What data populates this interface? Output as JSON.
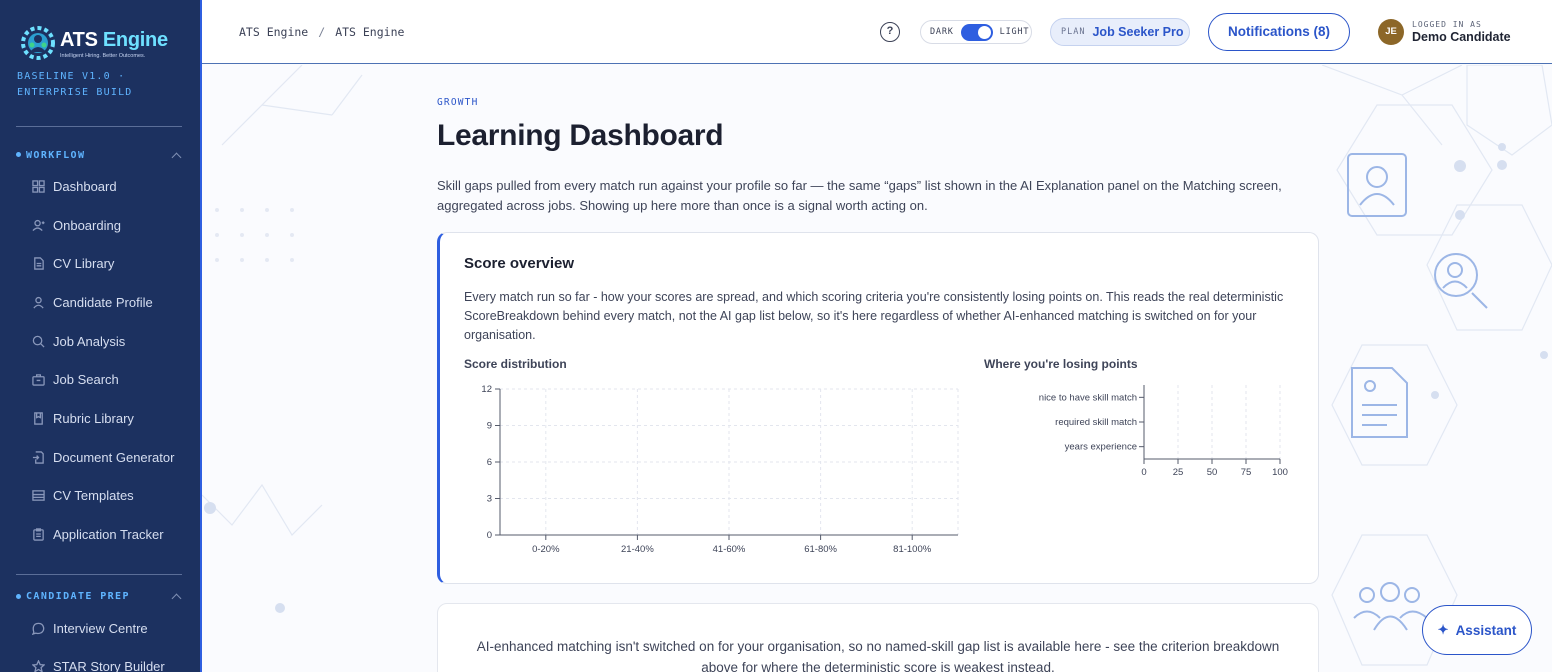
{
  "brand": {
    "name_main": "ATS",
    "name_accent": "Engine",
    "tagline": "Intelligent Hiring. Better Outcomes.",
    "build": "BASELINE V1.0 · ENTERPRISE BUILD"
  },
  "sidebar": {
    "sections": [
      {
        "label": "WORKFLOW",
        "items": [
          {
            "label": "Dashboard",
            "icon": "grid-icon"
          },
          {
            "label": "Onboarding",
            "icon": "user-plus-icon"
          },
          {
            "label": "CV Library",
            "icon": "document-icon"
          },
          {
            "label": "Candidate Profile",
            "icon": "user-icon"
          },
          {
            "label": "Job Analysis",
            "icon": "search-icon"
          },
          {
            "label": "Job Search",
            "icon": "briefcase-icon"
          },
          {
            "label": "Rubric Library",
            "icon": "book-icon"
          },
          {
            "label": "Document Generator",
            "icon": "file-export-icon"
          },
          {
            "label": "CV Templates",
            "icon": "layout-icon"
          },
          {
            "label": "Application Tracker",
            "icon": "clipboard-icon"
          }
        ]
      },
      {
        "label": "CANDIDATE PREP",
        "items": [
          {
            "label": "Interview Centre",
            "icon": "chat-icon"
          },
          {
            "label": "STAR Story Builder",
            "icon": "star-icon"
          }
        ]
      }
    ]
  },
  "topbar": {
    "breadcrumb": [
      "ATS Engine",
      "/",
      "ATS Engine"
    ],
    "help": "?",
    "theme_dark": "DARK",
    "theme_light": "LIGHT",
    "plan_label": "PLAN",
    "plan_value": "Job Seeker Pro",
    "notifications": "Notifications (8)",
    "avatar_initials": "JE",
    "logged_label": "LOGGED IN AS",
    "user_name": "Demo Candidate"
  },
  "page": {
    "eyebrow": "GROWTH",
    "title": "Learning Dashboard",
    "intro": "Skill gaps pulled from every match run against your profile so far — the same “gaps” list shown in the AI Explanation panel on the Matching screen, aggregated across jobs. Showing up here more than once is a signal worth acting on."
  },
  "score_card": {
    "title": "Score overview",
    "description": "Every match run so far - how your scores are spread, and which scoring criteria you're consistently losing points on. This reads the real deterministic ScoreBreakdown behind every match, not the AI gap list below, so it's here regardless of whether AI-enhanced matching is switched on for your organisation.",
    "dist_label": "Score distribution",
    "losing_label": "Where you're losing points"
  },
  "chart_data": [
    {
      "type": "bar",
      "title": "Score distribution",
      "categories": [
        "0-20%",
        "21-40%",
        "41-60%",
        "61-80%",
        "81-100%"
      ],
      "values": [
        0,
        0,
        0,
        0,
        0
      ],
      "yticks": [
        0,
        3,
        6,
        9,
        12
      ],
      "ylim": [
        0,
        12
      ],
      "grid": true,
      "xlabel": "",
      "ylabel": ""
    },
    {
      "type": "bar",
      "orientation": "horizontal",
      "title": "Where you're losing points",
      "categories": [
        "nice to have skill match",
        "required skill match",
        "years experience"
      ],
      "values": [
        0,
        0,
        0
      ],
      "xticks": [
        0,
        25,
        50,
        75,
        100
      ],
      "xlim": [
        0,
        100
      ],
      "grid": true,
      "xlabel": "",
      "ylabel": ""
    }
  ],
  "ai_card": {
    "text": "AI-enhanced matching isn't switched on for your organisation, so no named-skill gap list is available here - see the criterion breakdown above for where the deterministic score is weakest instead."
  },
  "assistant": {
    "icon": "✦",
    "label": "Assistant"
  },
  "colors": {
    "sidebar_bg": "#1c3160",
    "accent": "#2e5ee0",
    "brand_cyan": "#6ee0ff",
    "avatar_bg": "#8c6728"
  }
}
